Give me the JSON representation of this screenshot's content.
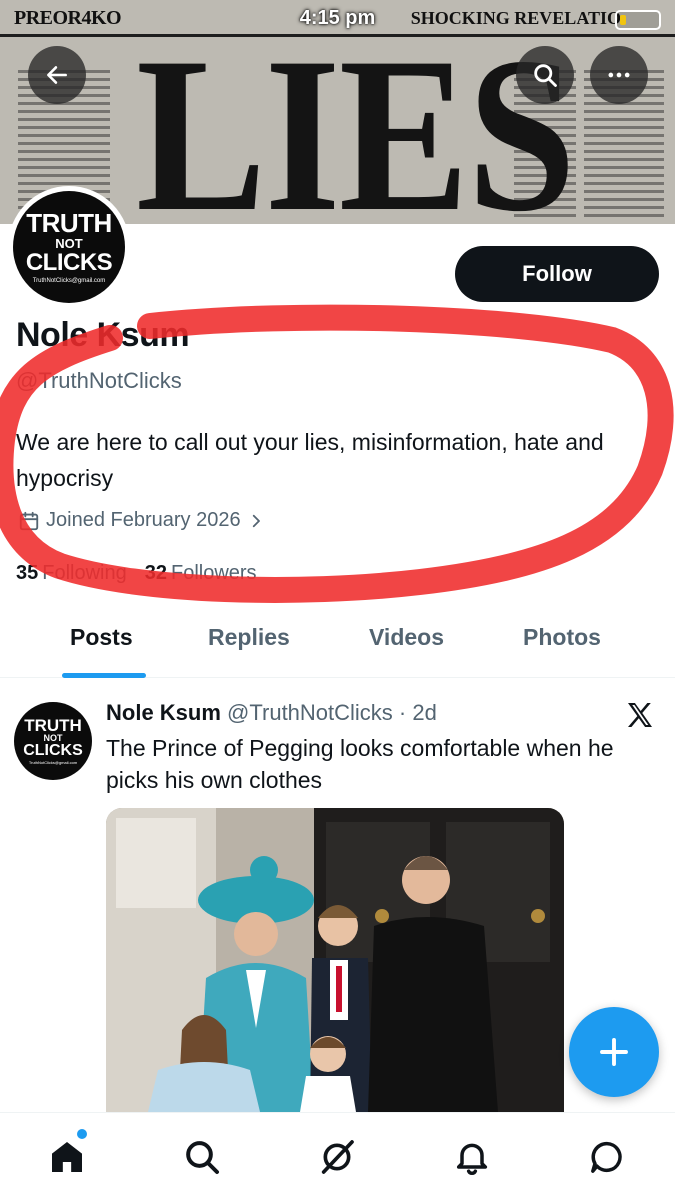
{
  "status_bar": {
    "left_text": "PREOR4KO",
    "time": "4:15 pm",
    "right_text": "SHOCKING REVELATIO"
  },
  "banner": {
    "headline": "LIES"
  },
  "profile": {
    "avatar": {
      "line1": "TRUTH",
      "line2": "NOT",
      "line3": "CLICKS",
      "line4": "TruthNotClicks@gmail.com"
    },
    "follow_label": "Follow",
    "display_name": "Nole Ksum",
    "handle": "@TruthNotClicks",
    "bio": "We are here to call out your lies, misinformation, hate and hypocrisy",
    "joined": "Joined February 2026",
    "following_count": "35",
    "following_label": "Following",
    "followers_count": "32",
    "followers_label": "Followers"
  },
  "tabs": [
    {
      "label": "Posts",
      "active": true
    },
    {
      "label": "Replies",
      "active": false
    },
    {
      "label": "Videos",
      "active": false
    },
    {
      "label": "Photos",
      "active": false
    }
  ],
  "post": {
    "author": "Nole Ksum",
    "handle_time": "@TruthNotClicks · 2d",
    "text": "The Prince of Pegging looks comfortable when he picks his own clothes",
    "avatar": {
      "line1": "TRUTH",
      "line2": "NOT",
      "line3": "CLICKS",
      "line4": "TruthNotClicks@gmail.com"
    }
  },
  "icons": {
    "back": "back-arrow-icon",
    "search": "search-icon",
    "more": "more-icon",
    "calendar": "calendar-icon",
    "x": "x-logo-icon",
    "compose": "plus-icon",
    "nav": [
      "home-icon",
      "search-icon",
      "grok-icon",
      "bell-icon",
      "message-icon"
    ]
  },
  "colors": {
    "accent": "#1d9bf0",
    "text": "#0f1419",
    "muted": "#536471",
    "annotation": "#ef2b2b"
  }
}
